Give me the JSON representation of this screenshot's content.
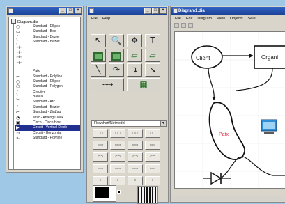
{
  "tree_window": {
    "title": "",
    "root_label": "Diagram.dia",
    "items": [
      {
        "label": "Standard - Ellipse",
        "symbol": "○"
      },
      {
        "label": "Standard - Box",
        "symbol": "▭"
      },
      {
        "label": "Standard - Bezier",
        "symbol": "∫"
      },
      {
        "label": "Standard - Bezier",
        "symbol": "∫"
      },
      {
        "label": "",
        "symbol": "⊣⊢"
      },
      {
        "label": "",
        "symbol": "⊣⊢"
      },
      {
        "label": "",
        "symbol": "⊣⊢"
      },
      {
        "label": "",
        "symbol": "⊣⊢"
      },
      {
        "label": "Patx",
        "symbol": "",
        "gap": true
      },
      {
        "label": "Standard - Polyline",
        "symbol": "⌐"
      },
      {
        "label": "Standard - Ellipse",
        "symbol": "○"
      },
      {
        "label": "Standard - Polygon",
        "symbol": "⬠"
      },
      {
        "label": "Crediive",
        "symbol": "∫"
      },
      {
        "label": "Banca",
        "symbol": "∫"
      },
      {
        "label": "Standard - Arc",
        "symbol": "⌒"
      },
      {
        "label": "Standard - Bezier",
        "symbol": "∫"
      },
      {
        "label": "Standard - ZigZag",
        "symbol": "⌐"
      },
      {
        "label": "Misc - Analog Clock",
        "symbol": "◔"
      },
      {
        "label": "Cisco - Cisco Host",
        "symbol": "▣"
      },
      {
        "label": "Circuit - Vertical Diode",
        "symbol": "▶",
        "selected": true
      },
      {
        "label": "Circuit - Horizontal",
        "symbol": "⊣"
      },
      {
        "label": "Standard - Polyline",
        "symbol": "∿"
      }
    ]
  },
  "tools_window": {
    "title": "",
    "menu": [
      "File",
      "Help"
    ],
    "tools": [
      {
        "name": "pointer-tool",
        "glyph": "↖"
      },
      {
        "name": "magnify-tool",
        "glyph": "🔍"
      },
      {
        "name": "move-tool",
        "glyph": "✥"
      },
      {
        "name": "text-tool",
        "glyph": "T"
      },
      {
        "name": "box-tool",
        "glyph": "",
        "rect": true
      },
      {
        "name": "ellipse-tool",
        "glyph": "",
        "rect": true
      },
      {
        "name": "polygon-tool",
        "glyph": "▱",
        "green": true
      },
      {
        "name": "beziergon-tool",
        "glyph": "▱",
        "green": true
      },
      {
        "name": "line-tool",
        "glyph": "╲"
      },
      {
        "name": "arc-tool",
        "glyph": "↷"
      },
      {
        "name": "zigzag-tool",
        "glyph": "↴"
      },
      {
        "name": "polyline-tool",
        "glyph": "↘"
      },
      {
        "name": "bezier-tool",
        "glyph": "⟿",
        "wide": true
      },
      {
        "name": "image-tool",
        "glyph": "▦",
        "wide": true,
        "green": true
      }
    ],
    "sheet_selector": "Flowchart/Netmodel",
    "sheet_tiles": [
      "◻◻",
      "◻◻",
      "◻◻",
      "◻◻",
      "▭▭",
      "▭▭",
      "▭▭",
      "▭▭",
      "⊏⊐",
      "⊏⊐",
      "⊏⊐",
      "⊏⊐",
      "▭▭",
      "▭▭",
      "▭▭",
      "▭▭",
      "⊣⊢",
      "⊣⊢",
      "⊣⊢",
      "⊣⊢"
    ]
  },
  "diagram_window": {
    "title": "Diagram1.dia",
    "menu": [
      "File",
      "Edit",
      "Diagram",
      "View",
      "Objects",
      "Sele"
    ],
    "shapes": {
      "client": "Client",
      "organization": "Organi",
      "patx": "Patx"
    },
    "colors": {
      "title_gradient_top": "#2f63c6",
      "patx_text": "#e8344a",
      "monitor": "#2e8fd6"
    }
  }
}
